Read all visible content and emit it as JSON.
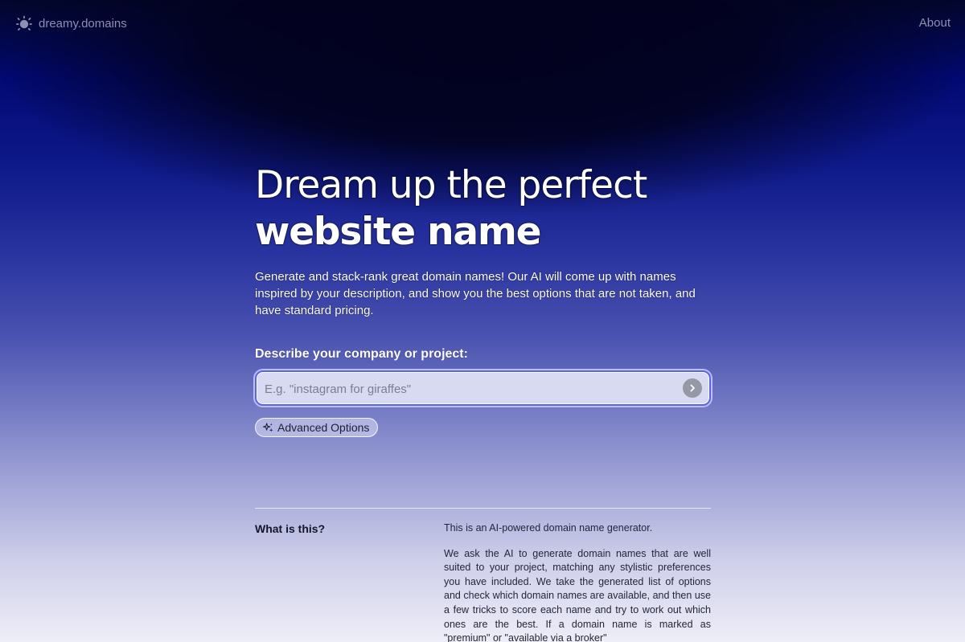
{
  "header": {
    "brand_name": "dreamy.domains",
    "brand_icon": "sun-icon",
    "about_label": "About"
  },
  "hero": {
    "title_line1": "Dream up the perfect",
    "title_line2": "website name",
    "intro": "Generate and stack-rank great domain names! Our AI will come up with names inspired by your description, and show you the best options that are not taken, and have standard pricing."
  },
  "search": {
    "label": "Describe your company or project:",
    "placeholder": "E.g. \"instagram for giraffes\"",
    "value": "",
    "submit_icon": "chevron-right-icon"
  },
  "advanced": {
    "label": "Advanced Options",
    "icon": "sparkles-icon"
  },
  "faq": {
    "question": "What is this?",
    "answer_p1": "This is an AI-powered domain name generator.",
    "answer_p2": "We ask the AI to generate domain names that are well suited to your project, matching any stylistic preferences you have included. We take the generated list of options and check which domain names are available, and then use a few tricks to score each name and try to work out which ones are the best. If a domain name is marked as \"premium\" or \"available via a broker\""
  },
  "colors": {
    "accent_border": "#5966e0",
    "muted_header_text": "#8d8fb3",
    "gradient_top": "#03062a",
    "gradient_bottom": "#eeeef8"
  }
}
